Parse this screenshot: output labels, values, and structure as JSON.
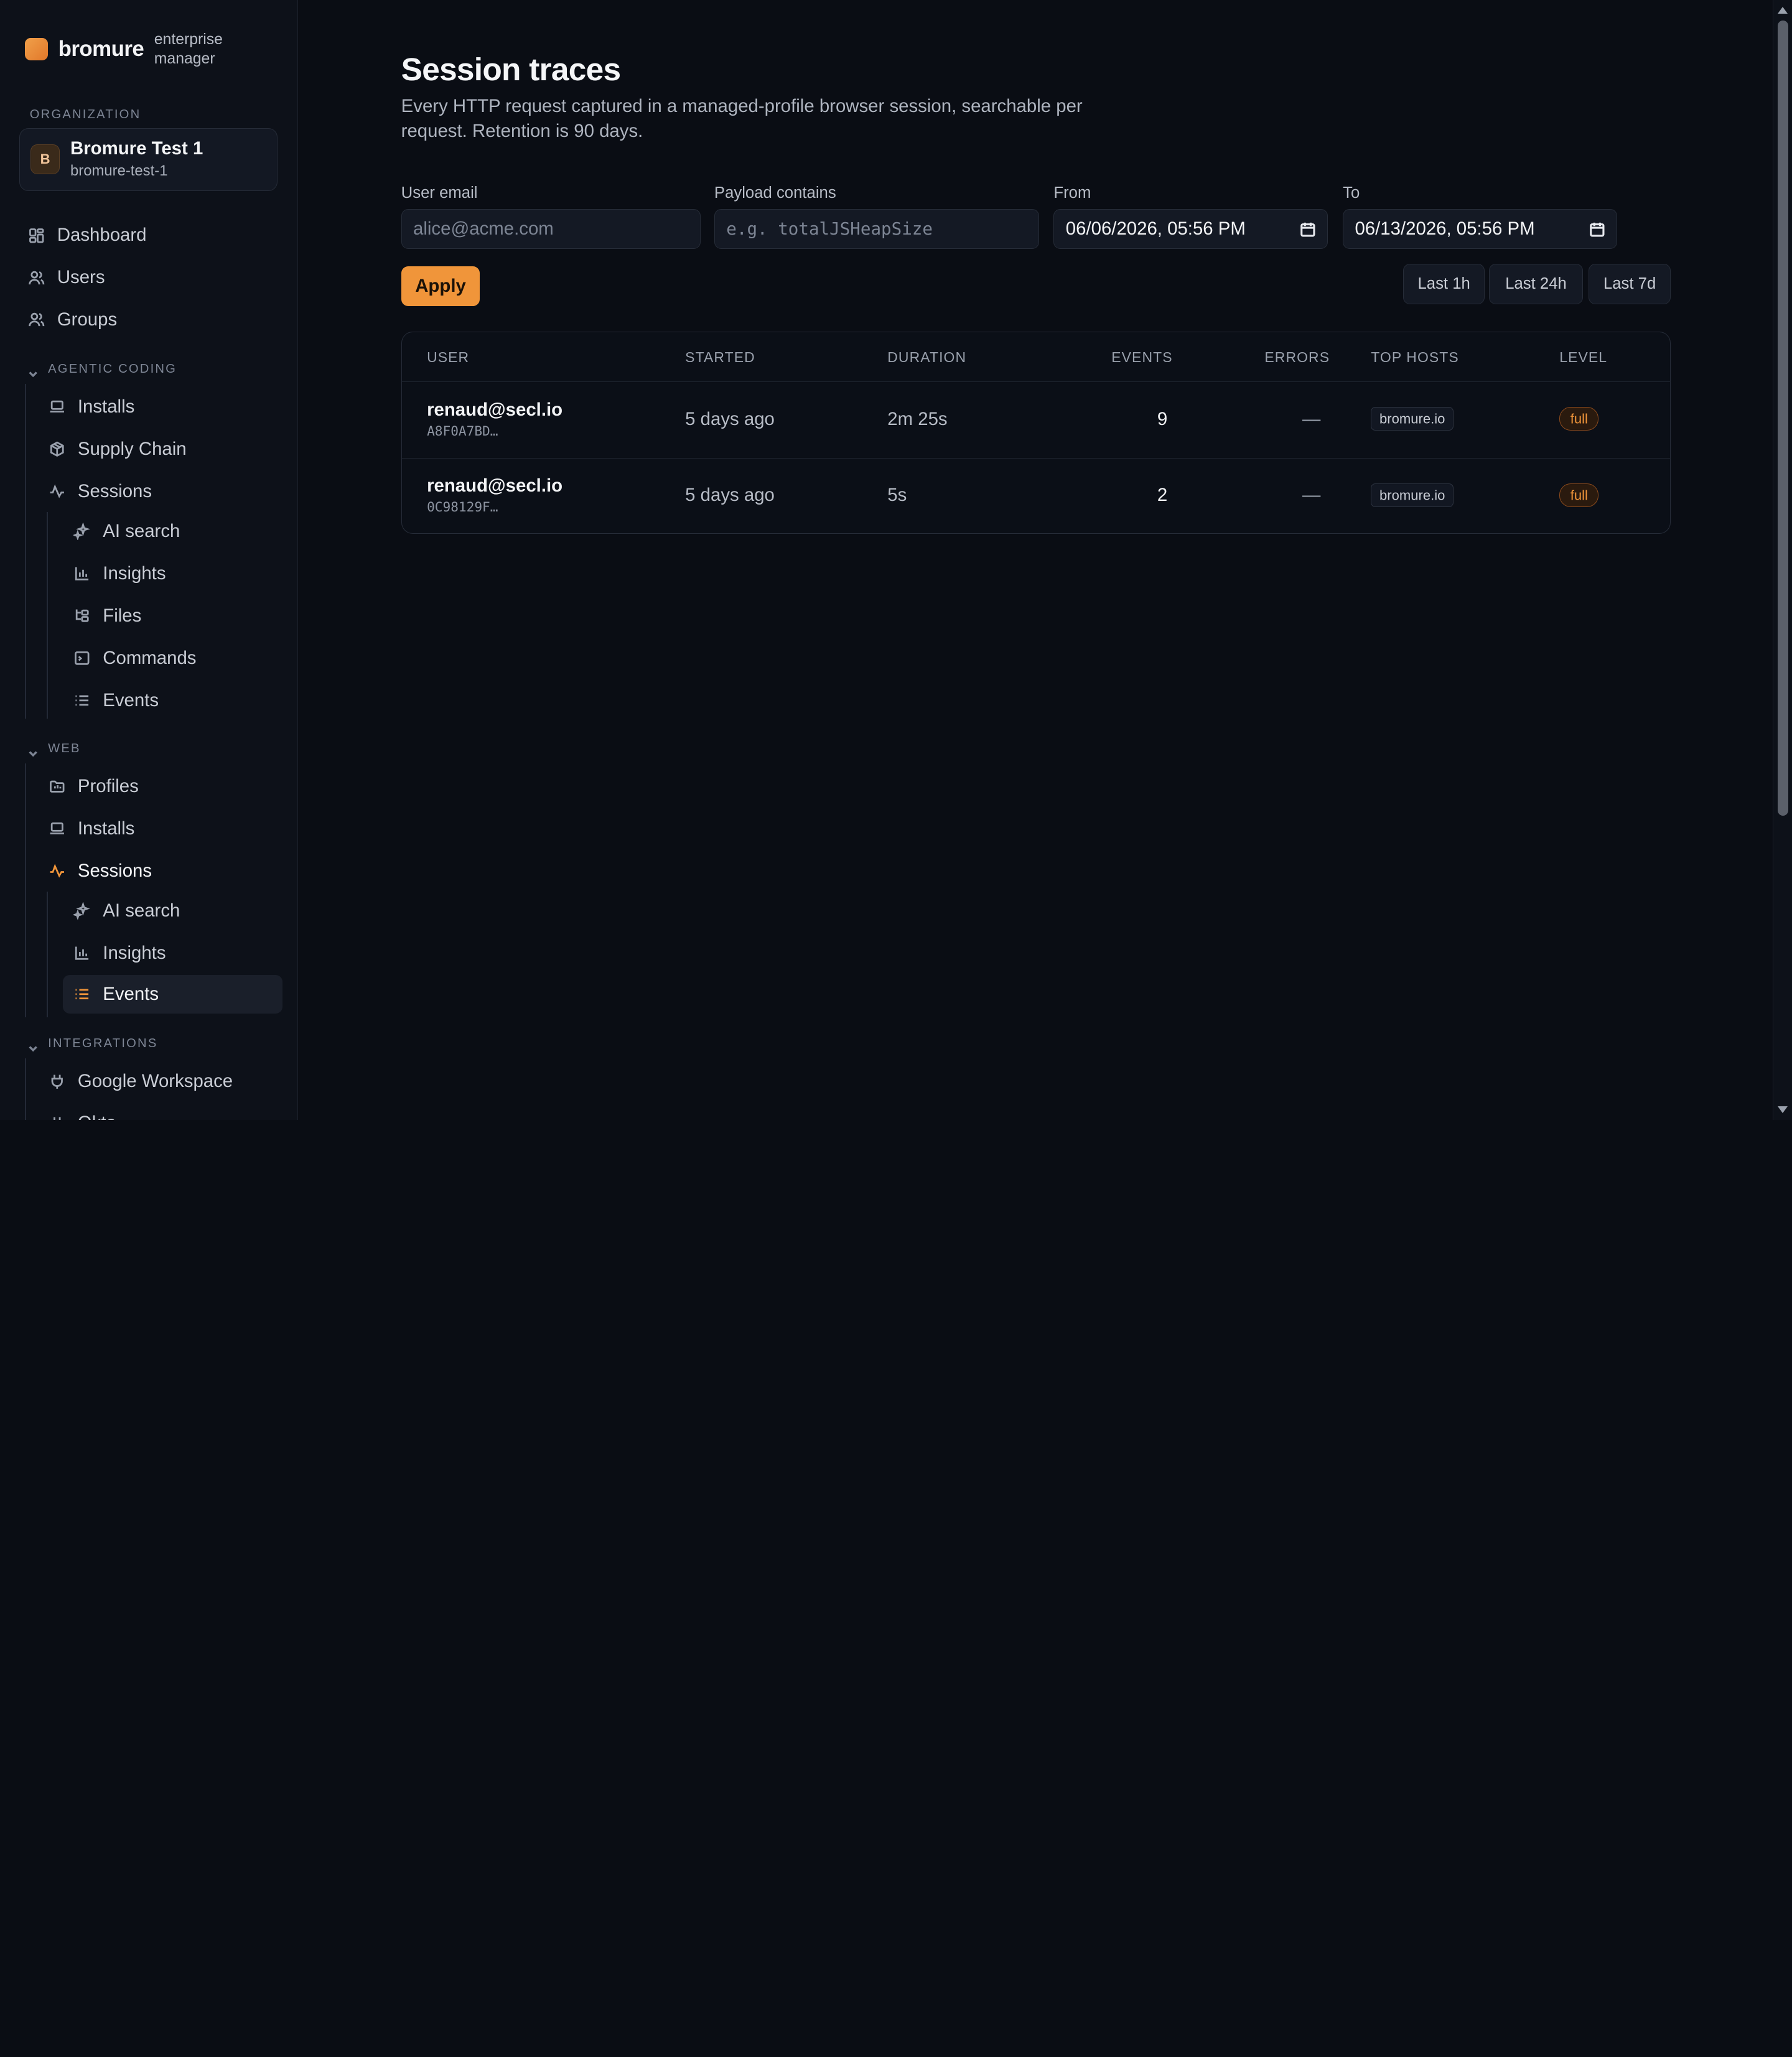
{
  "brand": {
    "name": "bromure",
    "sub": "enterprise manager"
  },
  "org": {
    "caption": "ORGANIZATION",
    "avatar": "B",
    "name": "Bromure Test 1",
    "slug": "bromure-test-1"
  },
  "nav": {
    "top": [
      {
        "label": "Dashboard",
        "icon": "dashboard-icon"
      },
      {
        "label": "Users",
        "icon": "user-icon"
      },
      {
        "label": "Groups",
        "icon": "users-icon"
      }
    ],
    "agentic": {
      "caption": "AGENTIC CODING",
      "items": [
        "Installs",
        "Supply Chain",
        "Sessions"
      ],
      "sessions_sub": [
        "AI search",
        "Insights",
        "Files",
        "Commands",
        "Events"
      ]
    },
    "web": {
      "caption": "WEB",
      "items": [
        "Profiles",
        "Installs",
        "Sessions"
      ],
      "sessions_sub": [
        "AI search",
        "Insights",
        "Events"
      ]
    },
    "integrations": {
      "caption": "INTEGRATIONS",
      "items": [
        "Google Workspace",
        "Okta"
      ]
    }
  },
  "page": {
    "title": "Session traces",
    "description": "Every HTTP request captured in a managed-profile browser session, searchable per request. Retention is 90 days."
  },
  "filters": {
    "email_label": "User email",
    "email_placeholder": "alice@acme.com",
    "payload_label": "Payload contains",
    "payload_placeholder": "e.g. totalJSHeapSize",
    "from_label": "From",
    "from_value": "06/06/2026, 05:56 PM",
    "to_label": "To",
    "to_value": "06/13/2026, 05:56 PM",
    "apply": "Apply",
    "quick": [
      "Last 1h",
      "Last 24h",
      "Last 7d"
    ]
  },
  "table": {
    "headers": [
      "USER",
      "STARTED",
      "DURATION",
      "EVENTS",
      "ERRORS",
      "TOP HOSTS",
      "LEVEL"
    ],
    "rows": [
      {
        "email": "renaud@secl.io",
        "id": "A8F0A7BD…",
        "started": "5 days ago",
        "duration": "2m 25s",
        "events": "9",
        "errors": "—",
        "host": "bromure.io",
        "level": "full"
      },
      {
        "email": "renaud@secl.io",
        "id": "0C98129F…",
        "started": "5 days ago",
        "duration": "5s",
        "events": "2",
        "errors": "—",
        "host": "bromure.io",
        "level": "full"
      }
    ]
  },
  "colors": {
    "accent": "#f0953a",
    "background": "#0a0d14",
    "sidebar": "#0d1119"
  }
}
